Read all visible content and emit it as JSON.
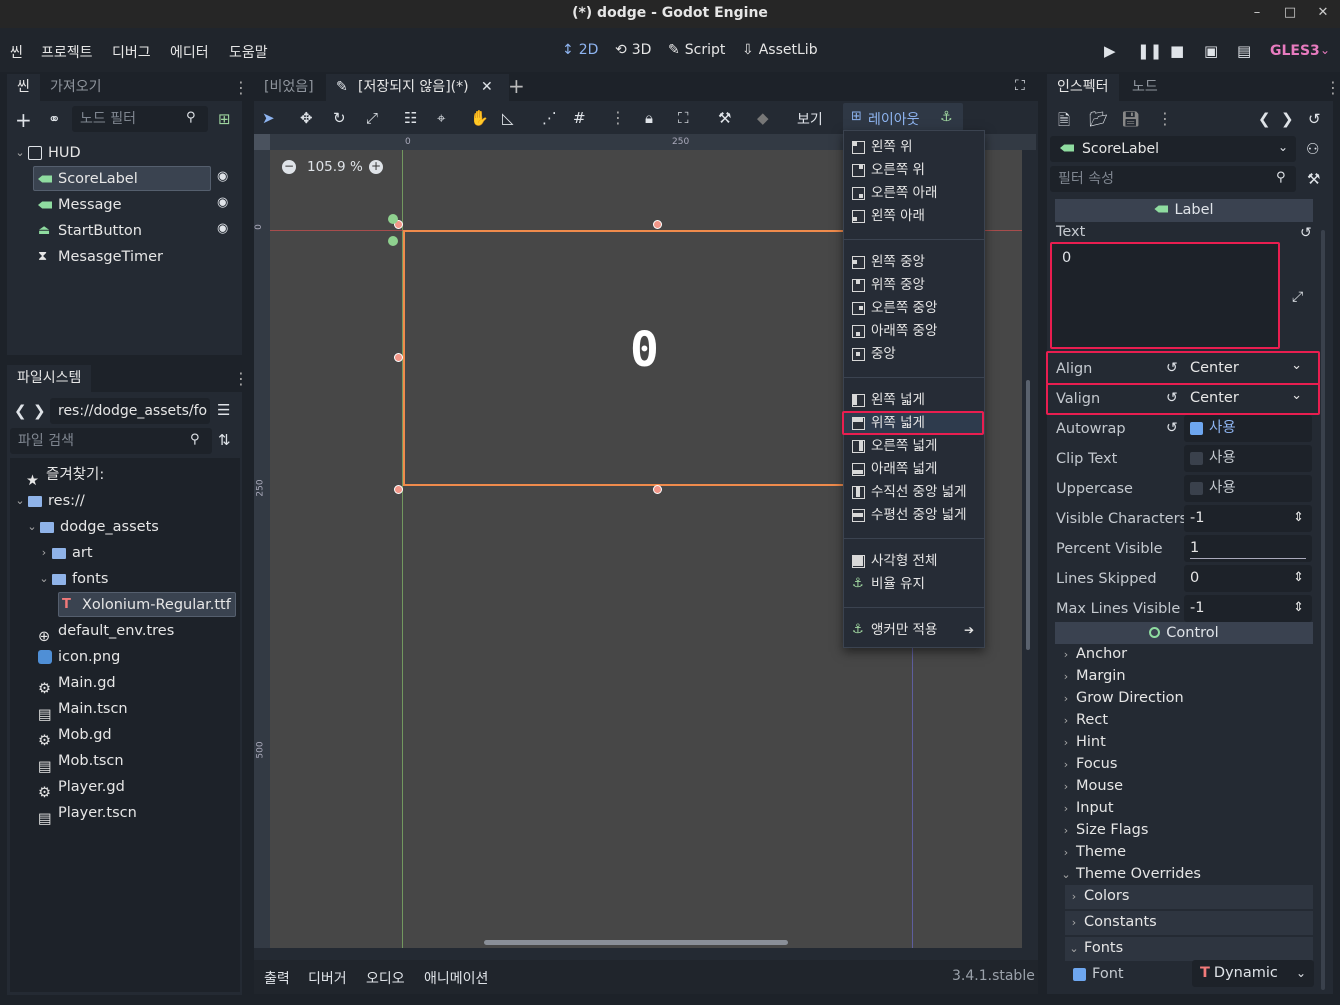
{
  "window": {
    "title": "(*) dodge - Godot Engine",
    "minimize": "–",
    "maximize": "□",
    "close": "✕"
  },
  "menu": {
    "items": [
      "씬",
      "프로젝트",
      "디버그",
      "에디터",
      "도움말"
    ],
    "modes": [
      {
        "label": "2D",
        "icon": "2d-icon"
      },
      {
        "label": "3D",
        "icon": "3d-icon"
      },
      {
        "label": "Script",
        "icon": "script-icon"
      },
      {
        "label": "AssetLib",
        "icon": "assetlib-icon"
      }
    ],
    "renderer": "GLES3"
  },
  "scene_dock": {
    "tabs": [
      "씬",
      "가져오기"
    ],
    "filter_placeholder": "노드 필터",
    "nodes": [
      {
        "label": "HUD",
        "icon": "control-icon"
      },
      {
        "label": "ScoreLabel",
        "icon": "label-icon",
        "selected": true
      },
      {
        "label": "Message",
        "icon": "label-icon"
      },
      {
        "label": "StartButton",
        "icon": "button-icon"
      },
      {
        "label": "MesasgeTimer",
        "icon": "timer-icon"
      }
    ]
  },
  "filesystem": {
    "tab": "파일시스템",
    "path": "res://dodge_assets/fo",
    "search_placeholder": "파일 검색",
    "favorites": "즐겨찾기:",
    "root": "res://",
    "dodge_assets": "dodge_assets",
    "art": "art",
    "fonts": "fonts",
    "font_file": "Xolonium-Regular.ttf",
    "files": [
      "default_env.tres",
      "icon.png",
      "Main.gd",
      "Main.tscn",
      "Mob.gd",
      "Mob.tscn",
      "Player.gd",
      "Player.tscn"
    ]
  },
  "editor": {
    "tabs": [
      "[비었음]",
      "[저장되지 않음](*)"
    ],
    "zoom": "105.9 %",
    "view_label": "보기",
    "layout_label": "레이아웃",
    "ruler_ticks": {
      "top": [
        "0",
        "250"
      ],
      "left": [
        "0",
        "250",
        "500"
      ]
    },
    "label_text": "0"
  },
  "layout_menu": {
    "group1": [
      "왼쪽 위",
      "오른쪽 위",
      "오른쪽 아래",
      "왼쪽 아래"
    ],
    "group2": [
      "왼쪽 중앙",
      "위쪽 중앙",
      "오른쪽 중앙",
      "아래쪽 중앙",
      "중앙"
    ],
    "group3": [
      "왼쪽 넓게",
      "위쪽 넓게",
      "오른쪽 넓게",
      "아래쪽 넓게",
      "수직선 중앙 넓게",
      "수평선 중앙 넓게"
    ],
    "group4": [
      "사각형 전체",
      "비율 유지"
    ],
    "group5": [
      "앵커만 적용"
    ],
    "highlighted": "위쪽 넓게"
  },
  "bottom": {
    "tabs": [
      "출력",
      "디버거",
      "오디오",
      "애니메이션"
    ],
    "version": "3.4.1.stable"
  },
  "inspector": {
    "tabs": [
      "인스펙터",
      "노드"
    ],
    "node_name": "ScoreLabel",
    "filter_placeholder": "필터 속성",
    "class_header": "Label",
    "text_label": "Text",
    "text_value": "0",
    "props": [
      {
        "label": "Align",
        "value": "Center",
        "kind": "dropdown",
        "revert": true
      },
      {
        "label": "Valign",
        "value": "Center",
        "kind": "dropdown",
        "revert": true
      },
      {
        "label": "Autowrap",
        "value": "사용",
        "kind": "check",
        "checked": true,
        "revert": true
      },
      {
        "label": "Clip Text",
        "value": "사용",
        "kind": "check",
        "checked": false
      },
      {
        "label": "Uppercase",
        "value": "사용",
        "kind": "check",
        "checked": false
      },
      {
        "label": "Visible Characters",
        "value": "-1",
        "kind": "spin"
      },
      {
        "label": "Percent Visible",
        "value": "1",
        "kind": "slider"
      },
      {
        "label": "Lines Skipped",
        "value": "0",
        "kind": "spin"
      },
      {
        "label": "Max Lines Visible",
        "value": "-1",
        "kind": "spin"
      }
    ],
    "control_header": "Control",
    "sections": [
      "Anchor",
      "Margin",
      "Grow Direction",
      "Rect",
      "Hint",
      "Focus",
      "Mouse",
      "Input",
      "Size Flags",
      "Theme",
      "Theme Overrides"
    ],
    "subsections": [
      "Colors",
      "Constants",
      "Fonts"
    ],
    "font_label": "Font",
    "font_value": "Dynamic"
  },
  "colors": {
    "accent": "#8eb4f0",
    "highlight": "#e91e50",
    "selection_rect": "#f08b4c",
    "renderer": "#e77bbf"
  }
}
